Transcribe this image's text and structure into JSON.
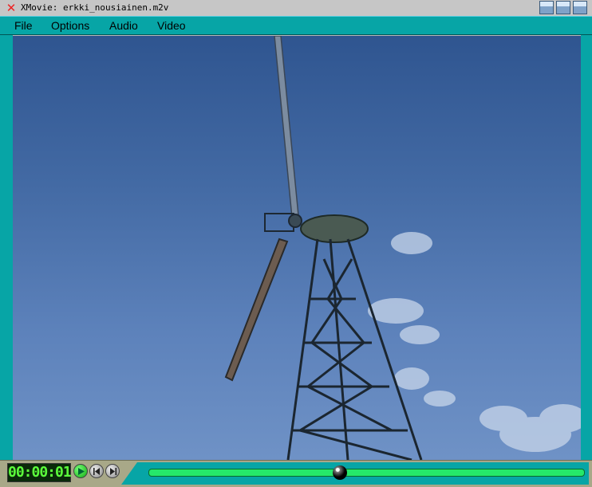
{
  "window": {
    "title": "XMovie: erkki_nousiainen.m2v",
    "close_glyph": "✕"
  },
  "menu": {
    "items": [
      "File",
      "Options",
      "Audio",
      "Video"
    ]
  },
  "player": {
    "time_display": "00:00:01",
    "progress": 0.44
  },
  "colors": {
    "accent": "#07a5a6",
    "track": "#25e86a"
  }
}
